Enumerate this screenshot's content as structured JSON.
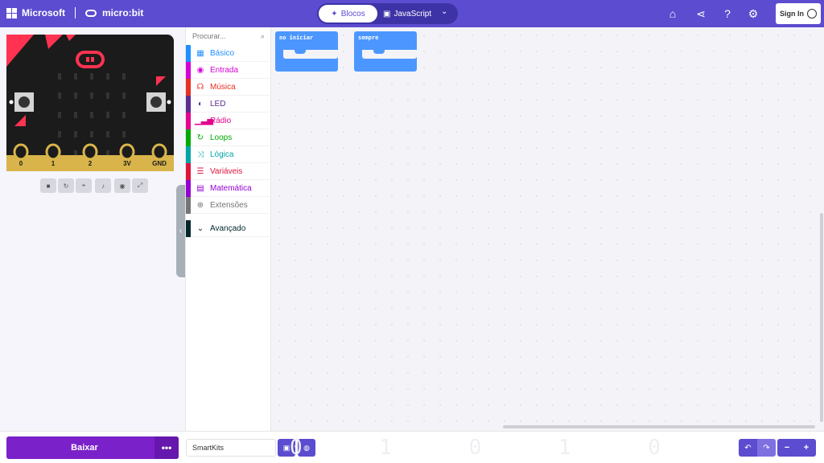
{
  "header": {
    "brand_microsoft": "Microsoft",
    "brand_microbit": "micro:bit",
    "mode_blocks": "Blocos",
    "mode_javascript": "JavaScript",
    "sign_in": "Sign In",
    "icons": [
      "home-icon",
      "share-icon",
      "help-icon",
      "gear-icon"
    ],
    "accent_color": "#5c4ccf"
  },
  "simulator": {
    "pins": [
      "0",
      "1",
      "2",
      "3V",
      "GND"
    ],
    "button_a": "A",
    "button_b": "B",
    "controls": [
      "stop-icon",
      "restart-icon",
      "slow-motion-icon",
      "sound-icon",
      "screenshot-icon",
      "fullscreen-icon"
    ]
  },
  "toolbox": {
    "search_placeholder": "Procurar...",
    "categories": [
      {
        "label": "Básico",
        "color": "#1e90ff"
      },
      {
        "label": "Entrada",
        "color": "#d400d4"
      },
      {
        "label": "Música",
        "color": "#e63022"
      },
      {
        "label": "LED",
        "color": "#5c2d91"
      },
      {
        "label": "Rádio",
        "color": "#e3008c"
      },
      {
        "label": "Loops",
        "color": "#00aa00"
      },
      {
        "label": "Lógica",
        "color": "#00a4a6"
      },
      {
        "label": "Variáveis",
        "color": "#dc143c"
      },
      {
        "label": "Matemática",
        "color": "#9400d3"
      },
      {
        "label": "Extensões",
        "color": "#757575"
      },
      {
        "label": "Avançado",
        "color": "#00272b"
      }
    ]
  },
  "workspace": {
    "blocks": [
      {
        "label": "no iniciar"
      },
      {
        "label": "sempre"
      }
    ]
  },
  "bottom": {
    "download_label": "Baixar",
    "more_label": "•••",
    "project_name": "SmartKits",
    "deco_text": "0 1 0 1 0 1 0 1"
  }
}
